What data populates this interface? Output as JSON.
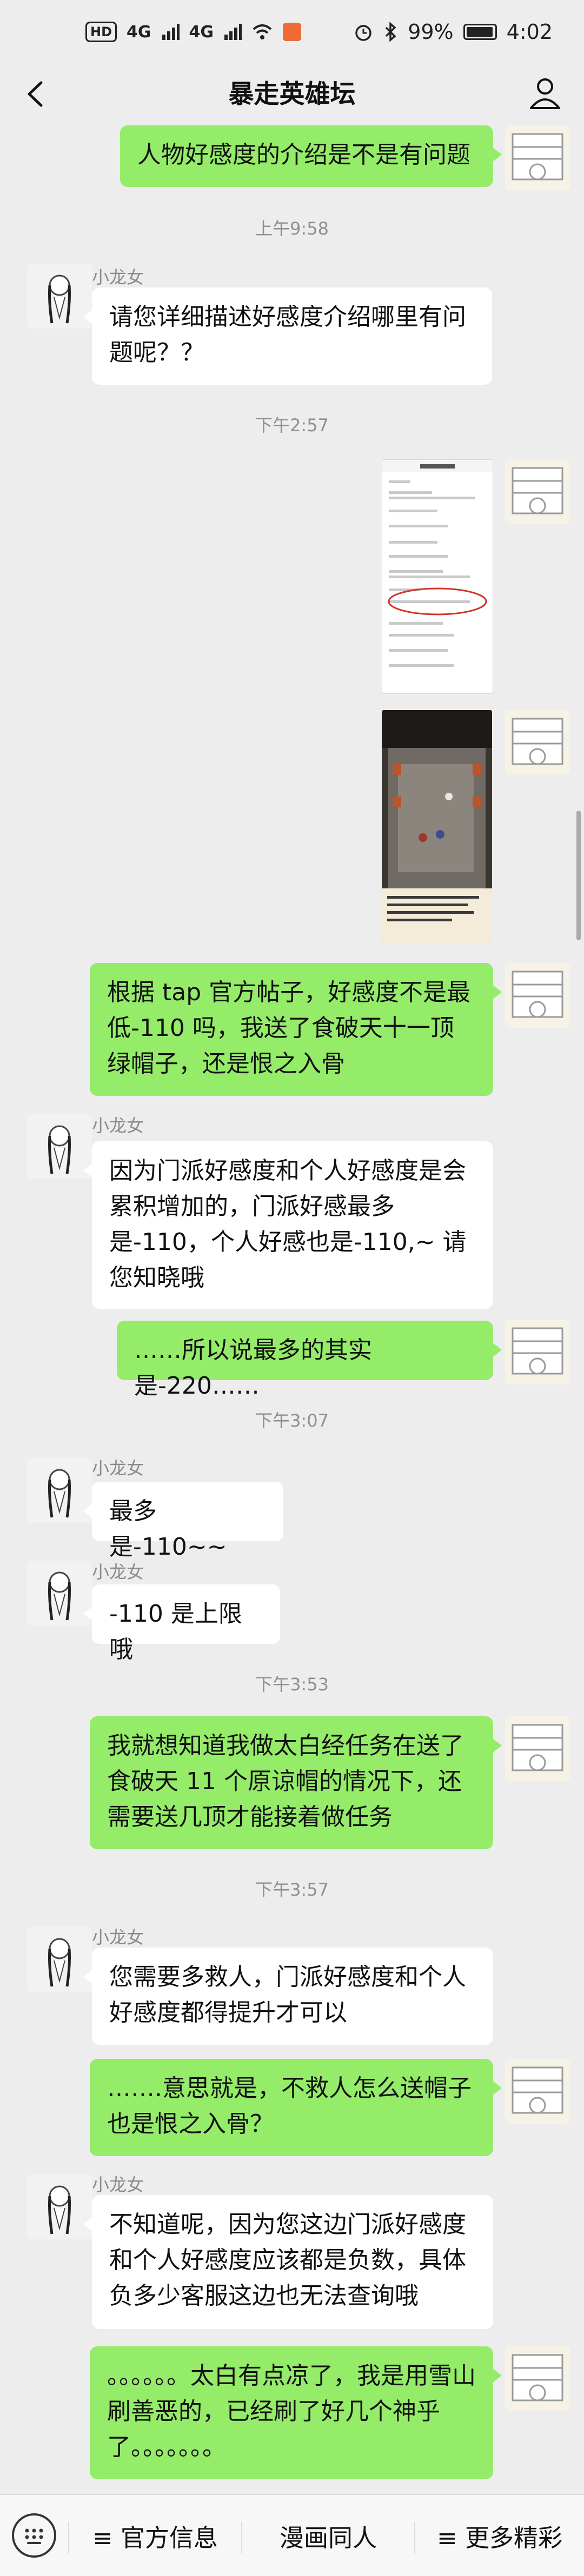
{
  "status_bar": {
    "hd_badge": "HD",
    "signal_1": "4G",
    "signal_2": "4G",
    "battery": "99%",
    "time": "4:02"
  },
  "nav": {
    "title": "暴走英雄坛",
    "back_icon": "chevron-left-icon",
    "profile_icon": "person-icon"
  },
  "messages": [
    {
      "from": "me",
      "text": "人物好感度的介绍是不是有问题"
    },
    {
      "type": "time",
      "text": "上午9:58"
    },
    {
      "from": "other",
      "name": "小龙女",
      "text": "请您详细描述好感度介绍哪里有问题呢？？"
    },
    {
      "type": "time",
      "text": "下午2:57"
    },
    {
      "from": "me",
      "type": "image",
      "desc": "screenshot-settings"
    },
    {
      "from": "me",
      "type": "image",
      "desc": "screenshot-game"
    },
    {
      "from": "me",
      "text": "根据 tap 官方帖子，好感度不是最低-110 吗，我送了食破天十一顶绿帽子，还是恨之入骨"
    },
    {
      "from": "other",
      "name": "小龙女",
      "text": "因为门派好感度和个人好感度是会累积增加的，门派好感最多是-110，个人好感也是-110,~ 请您知晓哦"
    },
    {
      "from": "me",
      "text": "……所以说最多的其实是-220……"
    },
    {
      "type": "time",
      "text": "下午3:07"
    },
    {
      "from": "other",
      "name": "小龙女",
      "text": "最多是-110~~"
    },
    {
      "from": "other",
      "name": "小龙女",
      "text": "-110 是上限哦"
    },
    {
      "type": "time",
      "text": "下午3:53"
    },
    {
      "from": "me",
      "text": "我就想知道我做太白经任务在送了食破天 11 个原谅帽的情况下，还需要送几顶才能接着做任务"
    },
    {
      "type": "time",
      "text": "下午3:57"
    },
    {
      "from": "other",
      "name": "小龙女",
      "text": "您需要多救人，门派好感度和个人好感度都得提升才可以"
    },
    {
      "from": "me",
      "text": "…….意思就是，不救人怎么送帽子也是恨之入骨？"
    },
    {
      "from": "other",
      "name": "小龙女",
      "text": "不知道呢，因为您这边门派好感度和个人好感度应该都是负数，具体负多少客服这边也无法查询哦"
    },
    {
      "from": "me",
      "text": "。。。。。。太白有点凉了，我是用雪山刷善恶的，已经刷了好几个神乎了。。。。。。。"
    }
  ],
  "bottom_menu": {
    "keyboard_icon": "keyboard-icon",
    "items": [
      "≡ 官方信息",
      "漫画同人",
      "≡ 更多精彩"
    ]
  },
  "colors": {
    "background": "#ededed",
    "my_bubble": "#95ec69",
    "other_bubble": "#ffffff"
  }
}
